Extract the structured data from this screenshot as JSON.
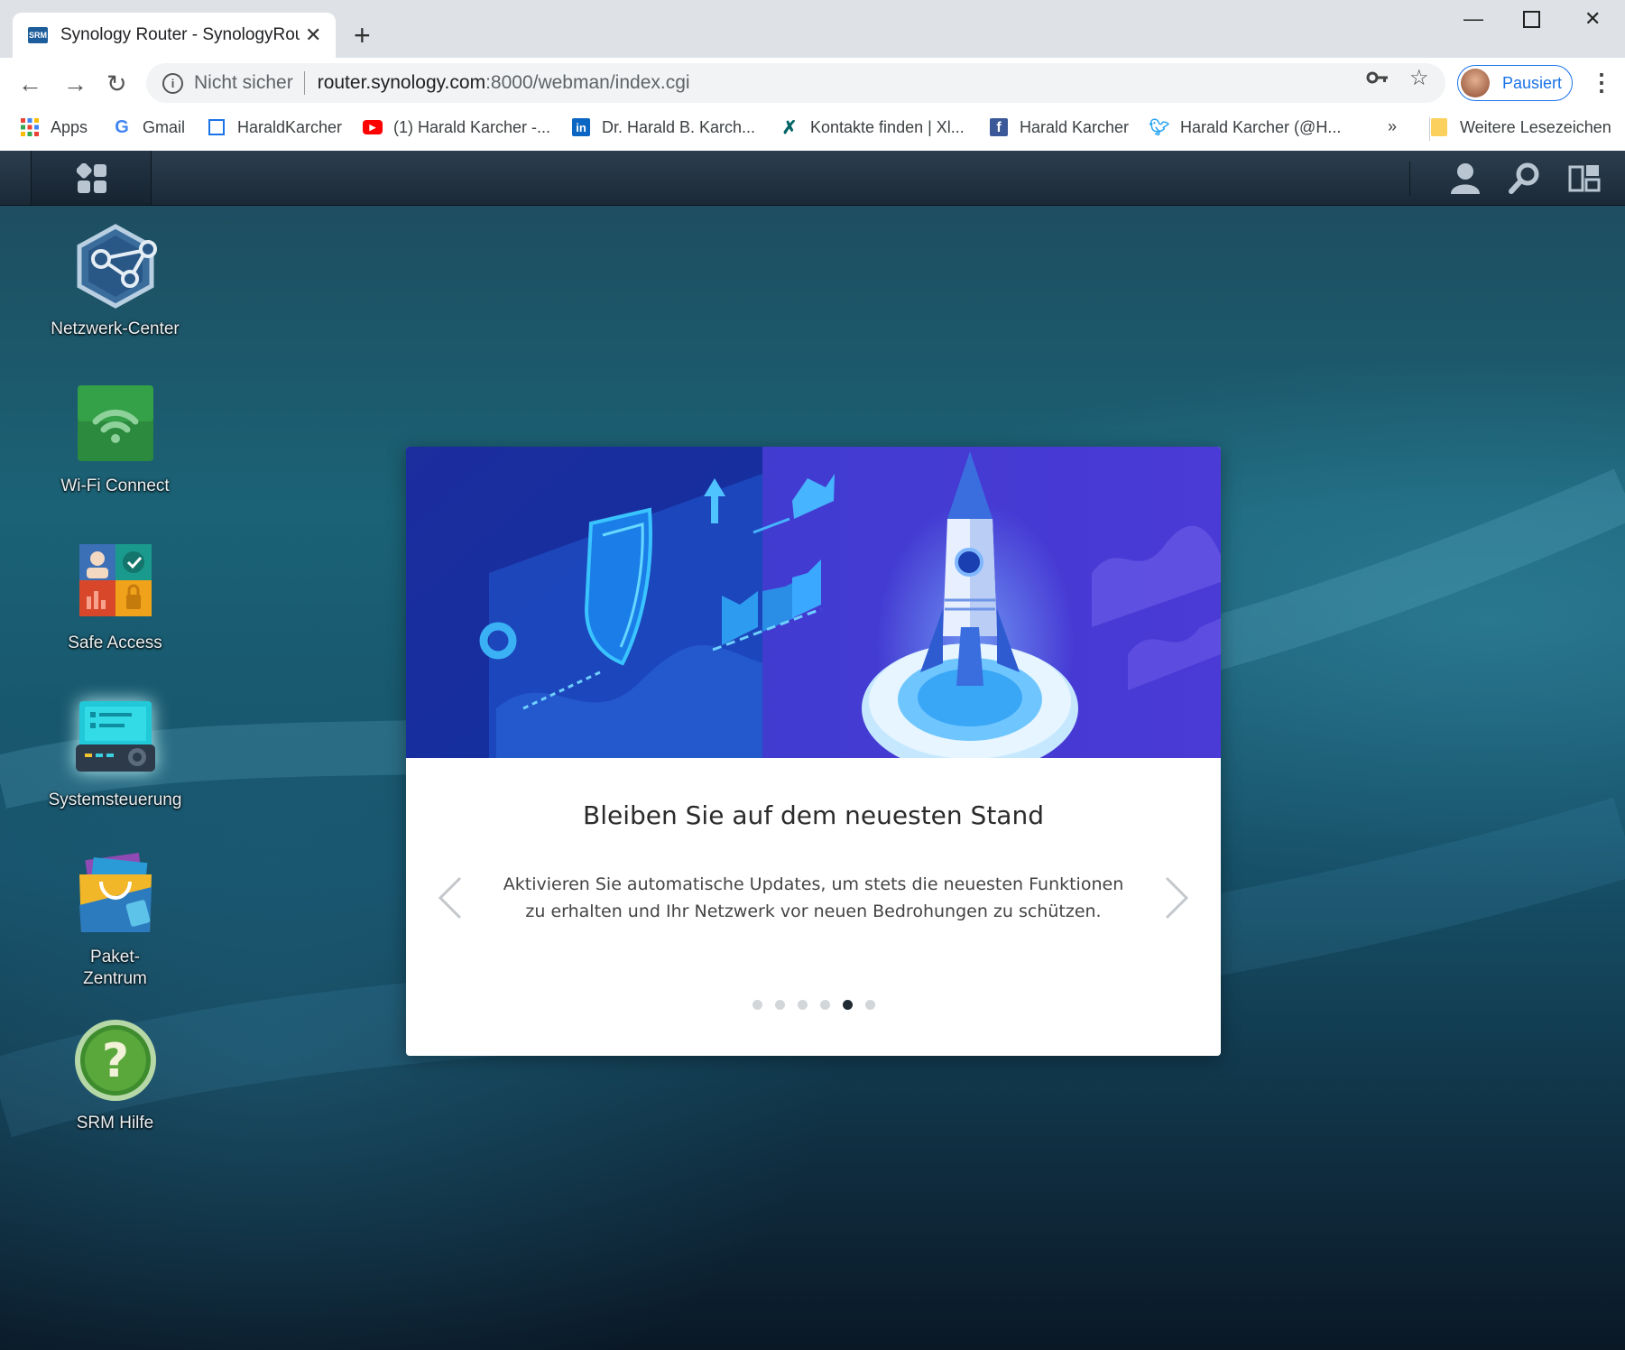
{
  "browser": {
    "tab_title": "Synology Router - SynologyRouter",
    "tab_favicon": "SRM",
    "new_tab": "+",
    "not_secure": "Nicht sicher",
    "url_host": "router.synology.com",
    "url_rest": ":8000/webman/index.cgi",
    "profile_label": "Pausiert",
    "bookmarks": [
      {
        "label": "Apps",
        "icon": "apps-grid-icon"
      },
      {
        "label": "Gmail",
        "icon": "google-icon"
      },
      {
        "label": "HaraldKarcher",
        "icon": "page-icon"
      },
      {
        "label": "(1) Harald Karcher -...",
        "icon": "youtube-icon"
      },
      {
        "label": "Dr. Harald B. Karch...",
        "icon": "linkedin-icon"
      },
      {
        "label": "Kontakte finden | Xl...",
        "icon": "xing-icon"
      },
      {
        "label": "Harald Karcher",
        "icon": "facebook-icon"
      },
      {
        "label": "Harald Karcher (@H...",
        "icon": "twitter-icon"
      }
    ],
    "more_bookmarks": "»",
    "other_bookmarks": "Weitere Lesezeichen"
  },
  "desktop": {
    "icons": [
      {
        "label": "Netzwerk-Center"
      },
      {
        "label": "Wi-Fi Connect"
      },
      {
        "label": "Safe Access"
      },
      {
        "label": "Systemsteuerung"
      },
      {
        "label_line1": "Paket-",
        "label_line2": "Zentrum"
      },
      {
        "label": "SRM Hilfe"
      }
    ]
  },
  "card": {
    "heading": "Bleiben Sie auf dem neuesten Stand",
    "description": "Aktivieren Sie automatische Updates, um stets die neuesten Funktionen zu erhalten und Ihr Netzwerk vor neuen Bedrohungen zu schützen.",
    "slide_count": 6,
    "active_slide": 5
  },
  "colors": {
    "accent_blue": "#1a73e8",
    "hero_blue": "#2a3fd0",
    "taskbar": "#1f2e3c"
  }
}
